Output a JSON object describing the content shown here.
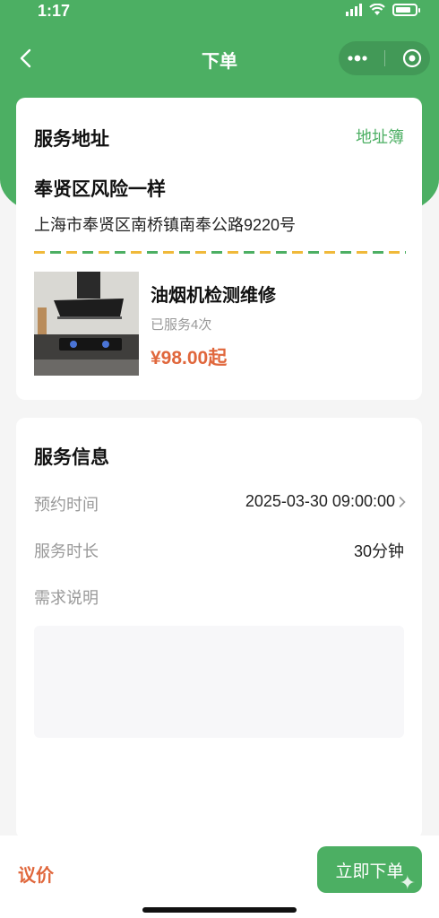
{
  "status_bar": {
    "time": "1:17"
  },
  "nav": {
    "title": "下单"
  },
  "address_card": {
    "section_title": "服务地址",
    "address_book_label": "地址簿",
    "name": "奉贤区风险一样",
    "detail": "上海市奉贤区南桥镇南奉公路9220号"
  },
  "product": {
    "name": "油烟机检测维修",
    "served": "已服务4次",
    "price": "¥98.00起"
  },
  "service_card": {
    "section_title": "服务信息",
    "rows": [
      {
        "label": "预约时间",
        "value": "2025-03-30 09:00:00"
      },
      {
        "label": "服务时长",
        "value": "30分钟"
      }
    ],
    "requirement_label": "需求说明",
    "requirement_value": ""
  },
  "bottom": {
    "bargain_label": "议价",
    "order_label": "立即下单"
  },
  "colors": {
    "brand_green": "#4caf63",
    "price_orange": "#e0673c"
  }
}
